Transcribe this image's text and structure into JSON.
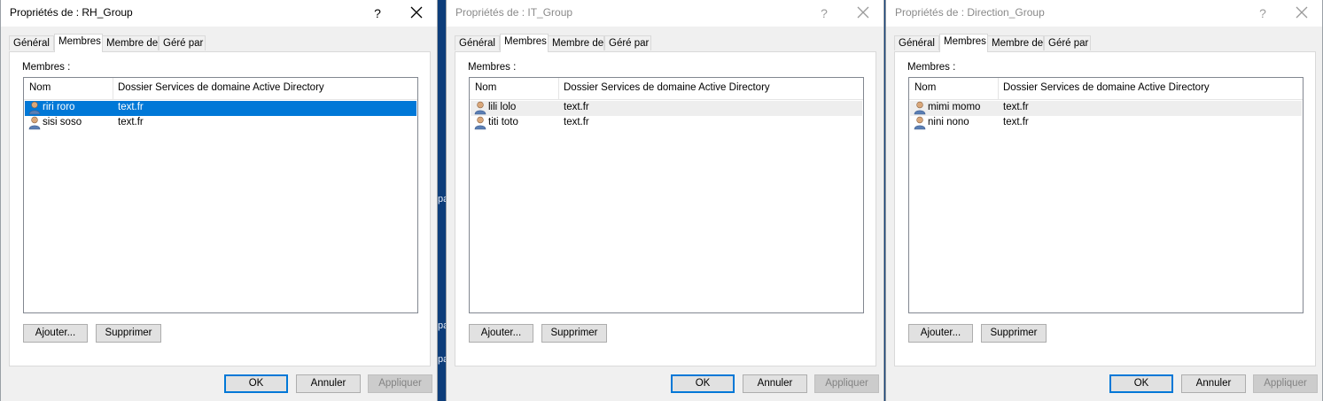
{
  "background": {
    "strip_color": "#0d3d7a",
    "fragments": [
      "pa",
      "pa",
      "pa"
    ]
  },
  "dialogs": [
    {
      "title": "Propriétés de : RH_Group",
      "active": true,
      "help_label": "?",
      "tabs": [
        "Général",
        "Membres",
        "Membre de",
        "Géré par"
      ],
      "active_tab": "Membres",
      "members_label": "Membres :",
      "columns": [
        "Nom",
        "Dossier Services de domaine Active Directory"
      ],
      "rows": [
        {
          "name": "riri roro",
          "folder": "text.fr",
          "state": "selected"
        },
        {
          "name": "sisi soso",
          "folder": "text.fr",
          "state": ""
        }
      ],
      "add_button": "Ajouter...",
      "remove_button": "Supprimer",
      "ok_button": "OK",
      "cancel_button": "Annuler",
      "apply_button": "Appliquer"
    },
    {
      "title": "Propriétés de : IT_Group",
      "active": false,
      "help_label": "?",
      "tabs": [
        "Général",
        "Membres",
        "Membre de",
        "Géré par"
      ],
      "active_tab": "Membres",
      "members_label": "Membres :",
      "columns": [
        "Nom",
        "Dossier Services de domaine Active Directory"
      ],
      "rows": [
        {
          "name": "lili lolo",
          "folder": "text.fr",
          "state": "hover"
        },
        {
          "name": "titi toto",
          "folder": "text.fr",
          "state": ""
        }
      ],
      "add_button": "Ajouter...",
      "remove_button": "Supprimer",
      "ok_button": "OK",
      "cancel_button": "Annuler",
      "apply_button": "Appliquer"
    },
    {
      "title": "Propriétés de : Direction_Group",
      "active": false,
      "help_label": "?",
      "tabs": [
        "Général",
        "Membres",
        "Membre de",
        "Géré par"
      ],
      "active_tab": "Membres",
      "members_label": "Membres :",
      "columns": [
        "Nom",
        "Dossier Services de domaine Active Directory"
      ],
      "rows": [
        {
          "name": "mimi momo",
          "folder": "text.fr",
          "state": "hover"
        },
        {
          "name": "nini nono",
          "folder": "text.fr",
          "state": ""
        }
      ],
      "add_button": "Ajouter...",
      "remove_button": "Supprimer",
      "ok_button": "OK",
      "cancel_button": "Annuler",
      "apply_button": "Appliquer"
    }
  ],
  "icons": {
    "close": "close-icon",
    "user": "user-icon"
  },
  "colors": {
    "selection": "#0078d7",
    "dialog_bg": "#f0f0f0"
  }
}
